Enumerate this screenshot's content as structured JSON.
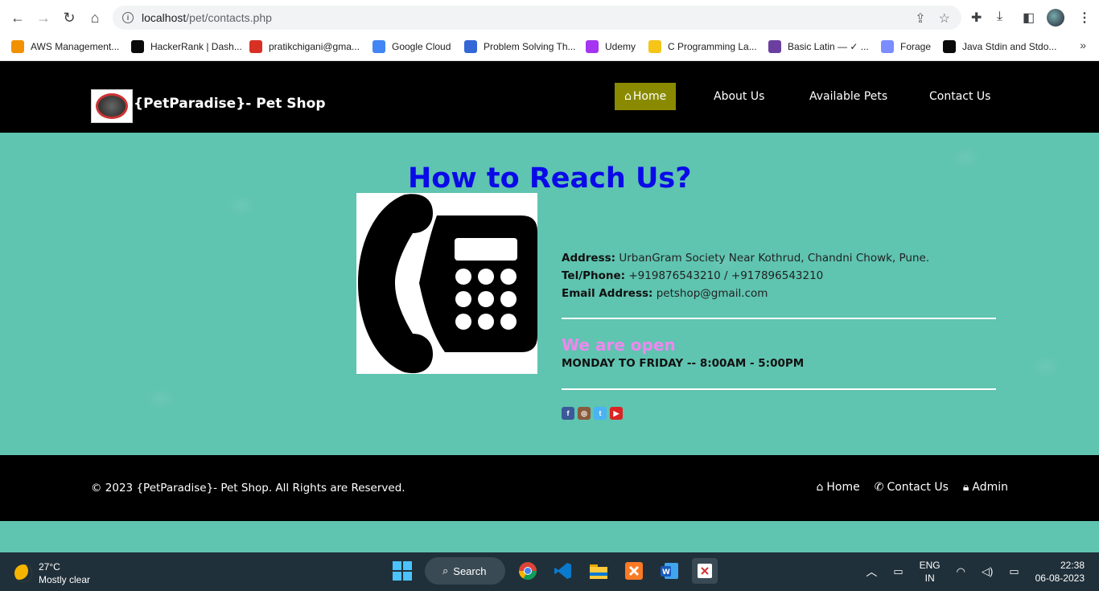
{
  "browser": {
    "url_host": "localhost",
    "url_path": "/pet/contacts.php",
    "bookmarks": [
      {
        "label": "AWS Management...",
        "icon": "aws-icon",
        "color": "#f29100"
      },
      {
        "label": "HackerRank | Dash...",
        "icon": "hackerrank-icon",
        "color": "#0a0a0a"
      },
      {
        "label": "pratikchigani@gma...",
        "icon": "gmail-icon",
        "color": "#d93025"
      },
      {
        "label": "Google Cloud",
        "icon": "google-cloud-icon",
        "color": "#4285f4"
      },
      {
        "label": "Problem Solving Th...",
        "icon": "problem-solving-icon",
        "color": "#3367d6"
      },
      {
        "label": "Udemy",
        "icon": "udemy-icon",
        "color": "#a435f0"
      },
      {
        "label": "C Programming La...",
        "icon": "c-programming-icon",
        "color": "#f5c518"
      },
      {
        "label": "Basic Latin — ✓ ...",
        "icon": "basic-latin-icon",
        "color": "#6b3fa0"
      },
      {
        "label": "Forage",
        "icon": "forage-icon",
        "color": "#7b8cff"
      },
      {
        "label": "Java Stdin and Stdo...",
        "icon": "hackerrank-icon",
        "color": "#0a0a0a"
      }
    ]
  },
  "site": {
    "brand": "{PetParadise}- Pet Shop",
    "nav": {
      "home": "Home",
      "about": "About Us",
      "pets": "Available Pets",
      "contact": "Contact Us"
    },
    "heading": "How to Reach Us?",
    "address_label": "Address:",
    "address": "UrbanGram Society Near Kothrud, Chandni Chowk, Pune.",
    "phone_label": "Tel/Phone:",
    "phone": "+919876543210 / +917896543210",
    "email_label": "Email Address:",
    "email": "petshop@gmail.com",
    "open_title": "We are open",
    "hours": "MONDAY TO FRIDAY -- 8:00AM - 5:00PM",
    "social": [
      "facebook-icon",
      "instagram-icon",
      "twitter-icon",
      "youtube-icon"
    ],
    "colors": {
      "header_bg": "#000000",
      "active_nav": "#8a8a00",
      "page_bg": "#5fc4b0",
      "heading": "#0a0ae8",
      "open": "#ee88ee"
    }
  },
  "footer": {
    "copyright": "© 2023 {PetParadise}- Pet Shop. All Rights are Reserved.",
    "links": {
      "home": "Home",
      "contact": "Contact Us",
      "admin": "Admin"
    }
  },
  "taskbar": {
    "temperature": "27°C",
    "weather": "Mostly clear",
    "search": "Search",
    "lang1": "ENG",
    "lang2": "IN",
    "time": "22:38",
    "date": "06-08-2023"
  }
}
